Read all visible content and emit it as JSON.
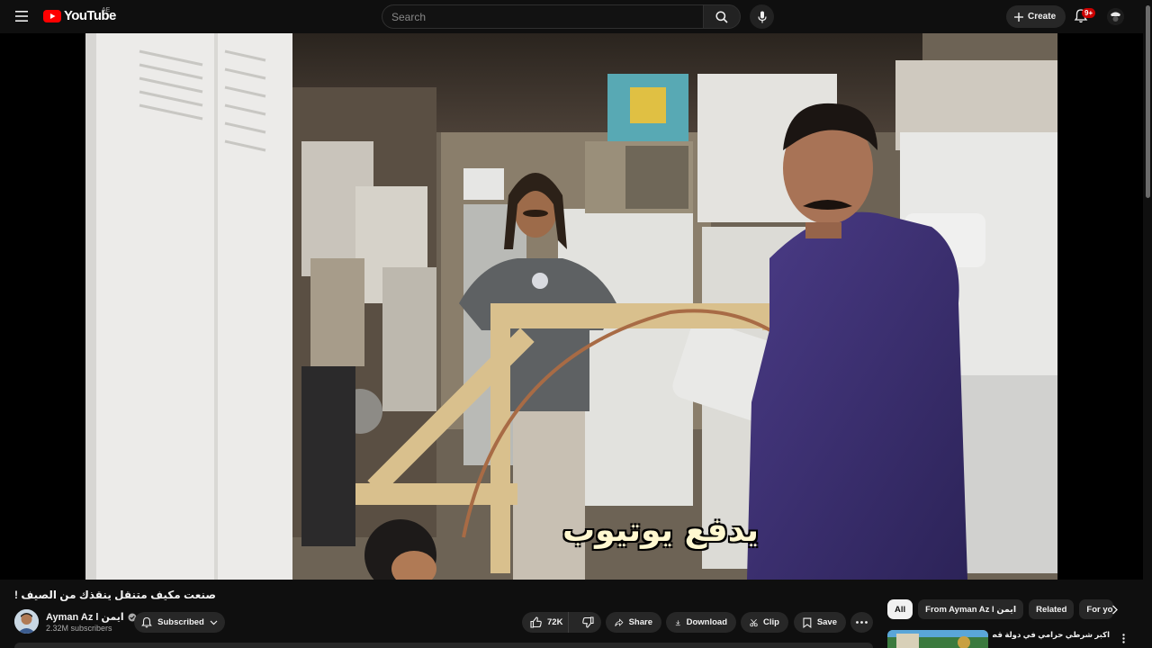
{
  "header": {
    "menu_icon": "hamburger-menu-icon",
    "logo_text": "YouTube",
    "country_code": "AE",
    "search_placeholder": "Search",
    "create_label": "Create",
    "notification_count": "9+"
  },
  "video": {
    "caption_text": "يدفع يوتيوب",
    "title": "صنعت مكيف متنقل ينقذك من الصيف !"
  },
  "channel": {
    "name": "Ayman Az l ايمن",
    "subscribers": "2.32M subscribers",
    "subscribe_label": "Subscribed"
  },
  "actions": {
    "likes": "72K",
    "share": "Share",
    "download": "Download",
    "clip": "Clip",
    "save": "Save"
  },
  "chips": [
    "All",
    "From Ayman Az l ايمن",
    "Related",
    "For you"
  ],
  "recommendation": {
    "title": "اكبر شرطي حرامي في دولة قطر🚓‼️"
  },
  "colors": {
    "background": "#0f0f0f",
    "surface": "#272727",
    "brand_red": "#ff0000",
    "badge_red": "#cc0000",
    "caption_yellow": "#fff8d0"
  }
}
